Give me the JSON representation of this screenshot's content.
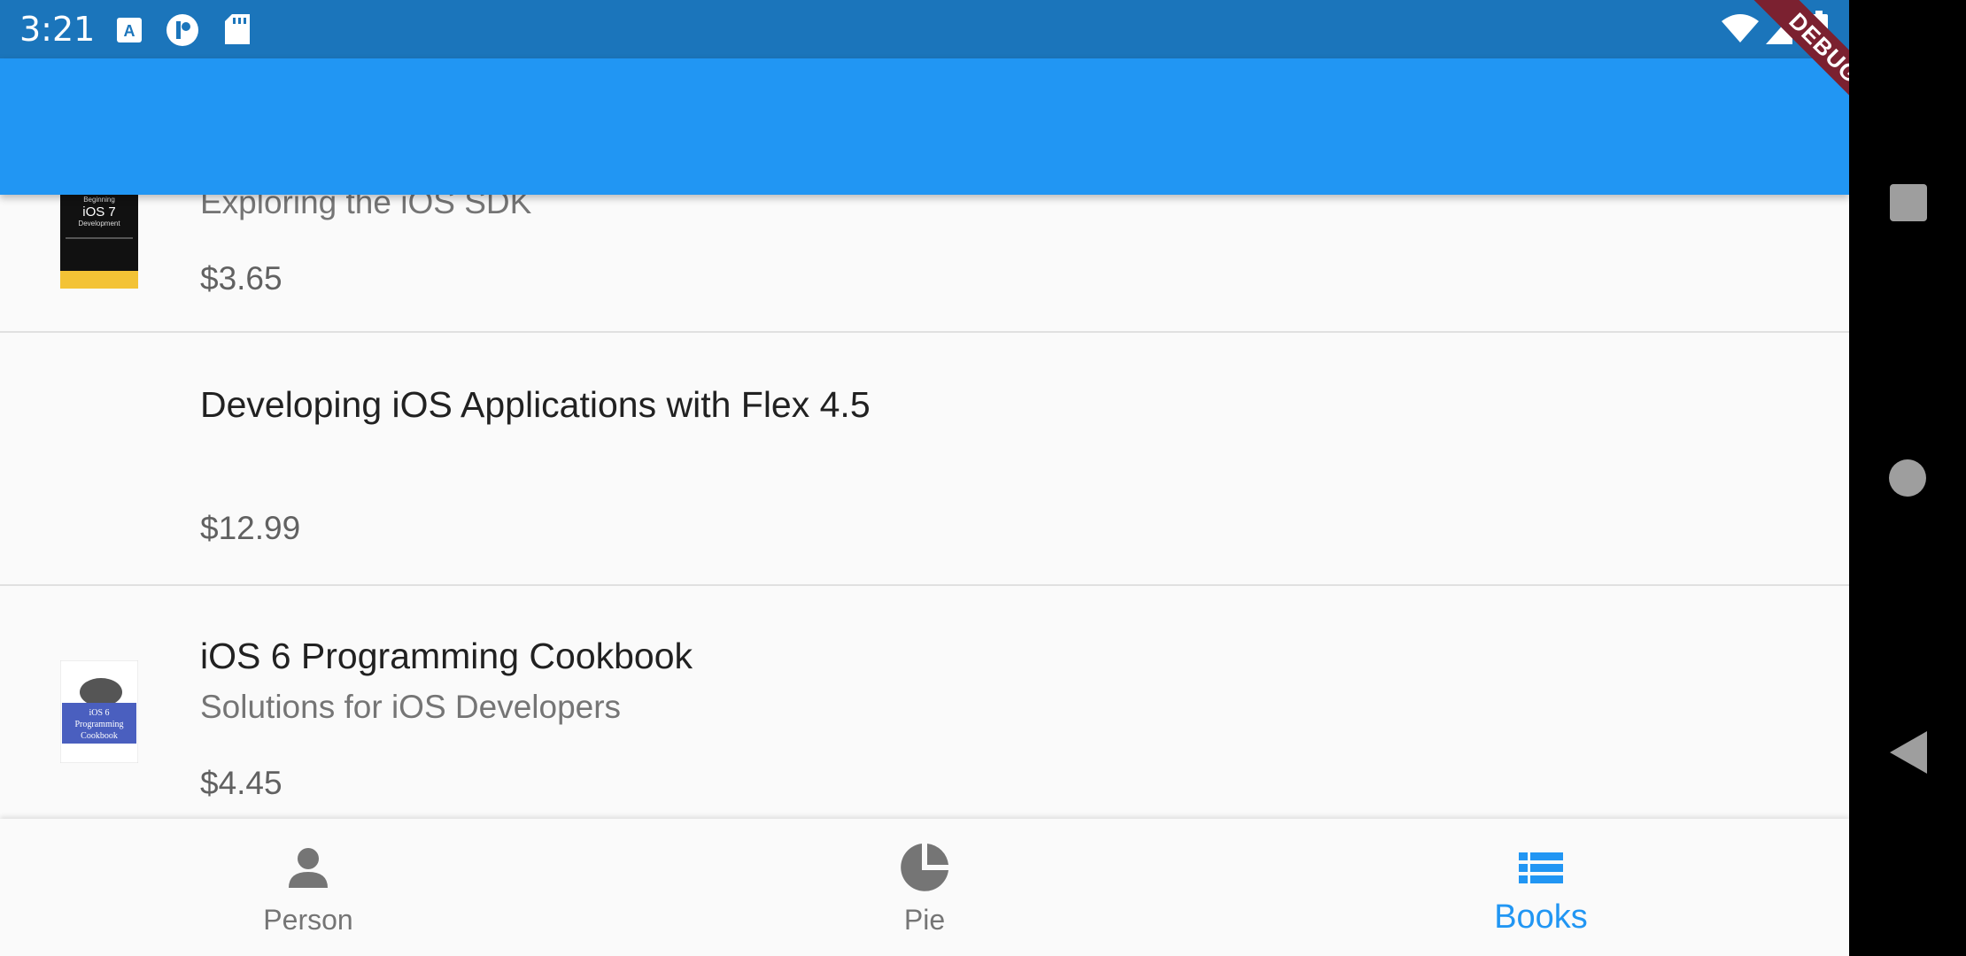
{
  "status_bar": {
    "time": "3:21",
    "icons": [
      "a-icon",
      "p-badge-icon",
      "sd-card-icon",
      "wifi-icon",
      "signal-icon",
      "battery-icon"
    ]
  },
  "debug_banner": "DEBUG",
  "books": [
    {
      "subtitle": "Exploring the iOS SDK",
      "price": "$3.65",
      "cover": "beginning-ios7-cover"
    },
    {
      "title": "Developing iOS Applications with Flex 4.5",
      "price": "$12.99"
    },
    {
      "title": "iOS 6 Programming Cookbook",
      "subtitle": "Solutions for iOS Developers",
      "price": "$4.45",
      "cover": "ios6-cookbook-cover"
    }
  ],
  "bottom_nav": {
    "tabs": [
      {
        "label": "Person",
        "icon": "person-icon"
      },
      {
        "label": "Pie",
        "icon": "pie-chart-icon"
      },
      {
        "label": "Books",
        "icon": "list-icon"
      }
    ],
    "selected": "Books",
    "active_color": "#2196f3",
    "inactive_color": "#757575"
  },
  "colors": {
    "app_bar": "#2196f3",
    "status_bar": "#1b75bb"
  }
}
